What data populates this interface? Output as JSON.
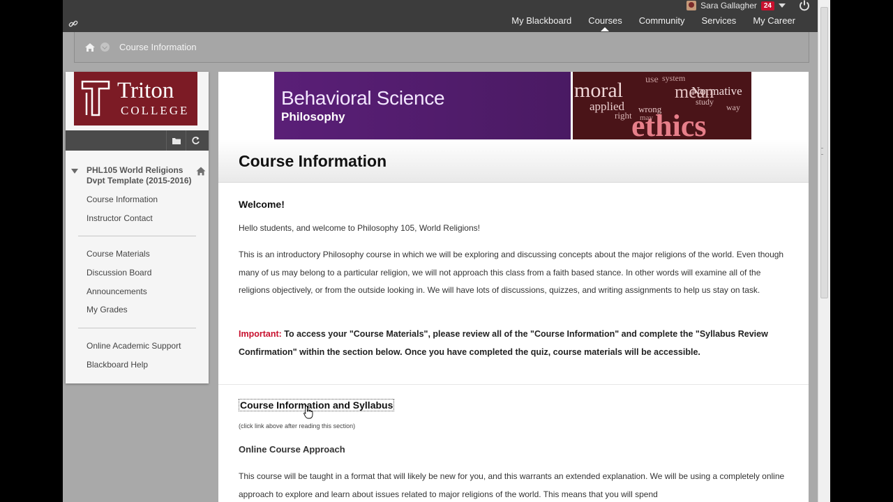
{
  "user": {
    "name": "Sara Gallagher",
    "notifications": "24"
  },
  "topnav": {
    "items": [
      {
        "label": "My Blackboard"
      },
      {
        "label": "Courses"
      },
      {
        "label": "Community"
      },
      {
        "label": "Services"
      },
      {
        "label": "My Career"
      }
    ],
    "active": "Courses"
  },
  "breadcrumb": {
    "current": "Course Information"
  },
  "logo": {
    "line1": "Triton",
    "line2": "COLLEGE"
  },
  "course": {
    "name": "PHL105 World Religions Dvpt Template (2015-2016)",
    "menu_group1": [
      "Course Information",
      "Instructor Contact"
    ],
    "menu_group2": [
      "Course Materials",
      "Discussion Board",
      "Announcements",
      "My Grades"
    ],
    "menu_group3": [
      "Online Academic Support",
      "Blackboard Help"
    ]
  },
  "banner": {
    "title": "Behavioral Science",
    "subtitle": "Philosophy",
    "words": [
      "moral",
      "applied",
      "right",
      "wrong",
      "Normative",
      "study",
      "way",
      "ethics",
      "system",
      "mean",
      "use",
      "may"
    ]
  },
  "page": {
    "title": "Course Information",
    "welcome": "Welcome!",
    "hello": "Hello students, and welcome to Philosophy 105, World Religions!",
    "intro": "This is an introductory Philosophy course in which we will be exploring and discussing concepts about the major religions of the world.  Even though many of us may belong to a particular religion, we will not approach this class from a faith based stance.  In other words will examine  all of the religions objectively, or from the outside looking in.    We will have lots of discussions, quizzes, and writing assignments to help us stay on task.",
    "important_label": "Important:",
    "important_text": "To access your \"Course Materials\", please review all of the \"Course Information\" and complete the \"Syllabus Review Confirmation\" within the section below.  Once you have completed the quiz, course materials will be accessible.",
    "syllabus_link": "Course Information and Syllabus",
    "syllabus_note": "(click link above after reading this section)",
    "approach_title": "Online Course Approach",
    "approach_text": "This course will be taught in a format that will likely be new for you, and this warrants an extended explanation. We will be using a completely online approach to explore and learn about issues related to major religions of the world. This means that you will spend"
  },
  "colors": {
    "brand_maroon": "#7c1b25",
    "banner_purple": "#5a1f77",
    "important_red": "#c8102e",
    "topbar": "#3c3c3c"
  }
}
